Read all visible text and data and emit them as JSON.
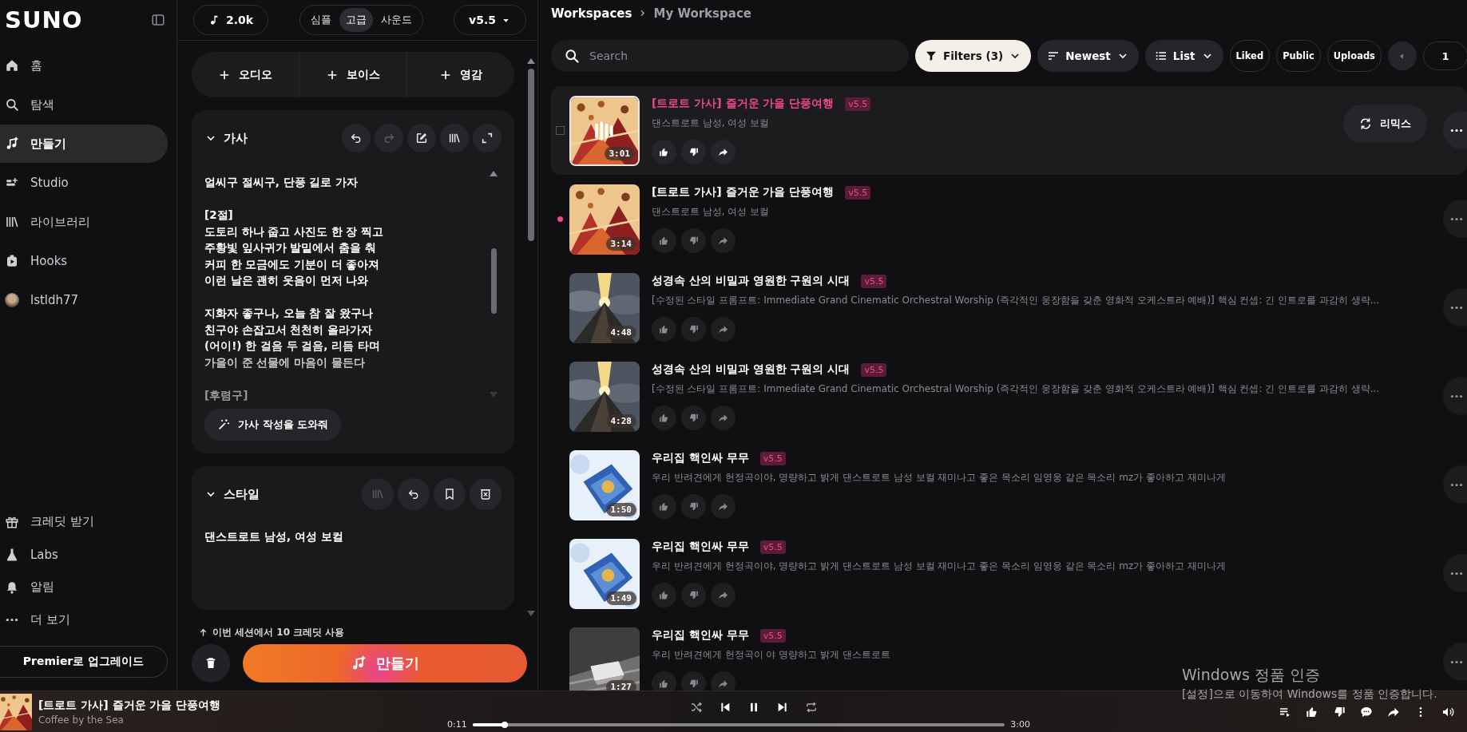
{
  "sidebar": {
    "logo": "SUNO",
    "nav": [
      {
        "label": "홈",
        "selected": false
      },
      {
        "label": "탐색",
        "selected": false
      },
      {
        "label": "만들기",
        "selected": true
      },
      {
        "label": "Studio",
        "selected": false
      },
      {
        "label": "라이브러리",
        "selected": false
      },
      {
        "label": "Hooks",
        "selected": false
      },
      {
        "label": "lstldh77",
        "selected": false
      }
    ],
    "bottom_nav": [
      "크레딧 받기",
      "Labs",
      "알림",
      "더 보기"
    ],
    "upgrade_button": "Premier로 업그레이드"
  },
  "create_panel": {
    "credits": "2.0k",
    "modes": [
      {
        "label": "심플",
        "selected": false
      },
      {
        "label": "고급",
        "selected": true
      },
      {
        "label": "사운드",
        "selected": false
      }
    ],
    "model": "v5.5",
    "add_buttons": [
      "오디오",
      "보이스",
      "영감"
    ],
    "lyrics": {
      "title": "가사",
      "expanded": true,
      "stanzas": [
        [
          "얼씨구 절씨구, 단풍 길로 가자"
        ],
        [
          "[2절]",
          "도토리 하나 줍고 사진도 한 장 찍고",
          "주황빛 잎사귀가 발밑에서 춤을 춰",
          "커피 한 모금에도 기분이 더 좋아져",
          "이런 날은 괜히 웃음이 먼저 나와"
        ],
        [
          "지화자 좋구나, 오늘 참 잘 왔구나",
          "친구야 손잡고서 천천히 올라가자",
          "(어이!) 한 걸음 두 걸음, 리듬 타며",
          "가을이 준 선물에 마음이 물든다"
        ],
        [
          "[후렴구]"
        ]
      ],
      "helper_button": "가사 작성을 도와줘"
    },
    "style": {
      "title": "스타일",
      "expanded": true,
      "text": "댄스트로트 남성, 여성 보컬"
    },
    "session_note": "이번 세션에서 10 크레딧 사용",
    "create_button": "만들기"
  },
  "workspace": {
    "breadcrumb": [
      "Workspaces",
      "My Workspace"
    ],
    "search": {
      "placeholder": "Search"
    },
    "filters_button": "Filters (3)",
    "sort_button": "Newest",
    "view_button": "List",
    "chips": [
      "Liked",
      "Public",
      "Uploads"
    ],
    "page": "1",
    "remix_button": "리믹스",
    "songs": [
      {
        "title": "[트로트 가사] 즐거운 가을 단풍여행",
        "version": "v5.5",
        "description": "댄스트로트 남성, 여성 보컬",
        "duration": "3:01",
        "playing": true,
        "hovered": true,
        "unseen": false
      },
      {
        "title": "[트로트 가사] 즐거운 가을 단풍여행",
        "version": "v5.5",
        "description": "댄스트로트 남성, 여성 보컬",
        "duration": "3:14",
        "playing": false,
        "hovered": false,
        "unseen": true
      },
      {
        "title": "성경속 산의 비밀과 영원한 구원의 시대",
        "version": "v5.5",
        "description": "[수정된 스타일 프롬프트: Immediate Grand Cinematic Orchestral Worship (즉각적인 웅장함을 갖춘 영화적 오케스트라 예배)] 핵심 컨셉: 긴 인트로를 과감히 생략...",
        "duration": "4:48",
        "playing": false,
        "hovered": false,
        "unseen": false
      },
      {
        "title": "성경속 산의 비밀과 영원한 구원의 시대",
        "version": "v5.5",
        "description": "[수정된 스타일 프롬프트: Immediate Grand Cinematic Orchestral Worship (즉각적인 웅장함을 갖춘 영화적 오케스트라 예배)] 핵심 컨셉: 긴 인트로를 과감히 생략...",
        "duration": "4:28",
        "playing": false,
        "hovered": false,
        "unseen": false
      },
      {
        "title": "우리집 핵인싸 무무",
        "version": "v5.5",
        "description": "우리 반려견에게 헌정곡이야, 명량하고 밝게 댄스트로트 남성 보컬 재미나고 좋은 목소리 임영웅 같은 목소리 mz가 좋아하고 재미나게",
        "duration": "1:50",
        "playing": false,
        "hovered": false,
        "unseen": false
      },
      {
        "title": "우리집 핵인싸 무무",
        "version": "v5.5",
        "description": "우리 반려견에게 헌정곡이야, 명량하고 밝게 댄스트로트 남성 보컬 재미나고 좋은 목소리 임영웅 같은 목소리 mz가 좋아하고 재미나게",
        "duration": "1:49",
        "playing": false,
        "hovered": false,
        "unseen": false
      },
      {
        "title": "우리집 핵인싸 무무",
        "version": "v5.5",
        "description": "우리 반려견에게 헌정곡이 야 명량하고 밝게 댄스트로트",
        "duration": "1:27",
        "playing": false,
        "hovered": false,
        "unseen": false
      }
    ]
  },
  "player": {
    "title": "[트로트 가사] 즐거운 가을 단풍여행",
    "artist": "Coffee by the Sea",
    "elapsed": "0:11",
    "total": "3:00",
    "progress": {
      "level": 0.06
    },
    "paused": false
  },
  "os_notice": {
    "title": "Windows 정품 인증",
    "text": "[설정]으로 이동하여 Windows를 정품 인증합니다."
  }
}
